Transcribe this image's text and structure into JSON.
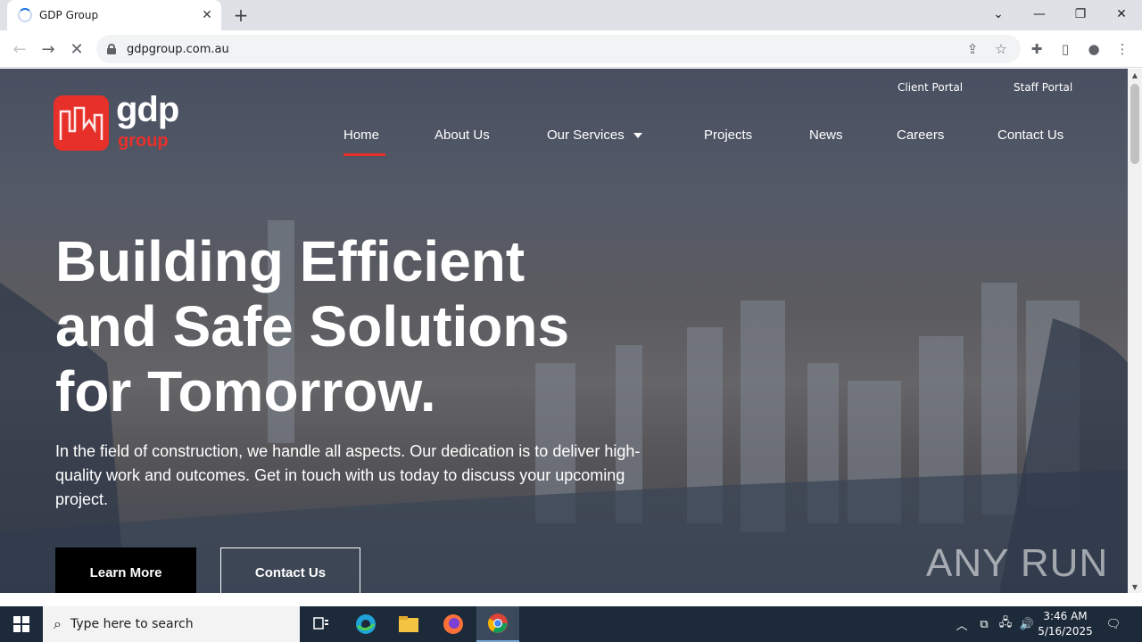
{
  "browser": {
    "tab_title": "GDP Group",
    "url": "gdpgroup.com.au"
  },
  "site": {
    "logo": {
      "main": "gdp",
      "sub": "group"
    },
    "portals": [
      "Client Portal",
      "Staff Portal"
    ],
    "nav": [
      "Home",
      "About Us",
      "Our Services",
      "Projects",
      "News",
      "Careers",
      "Contact Us"
    ],
    "active_nav": "Home",
    "hero": {
      "title_lines": [
        "Building Efficient",
        "and Safe Solutions",
        "for Tomorrow."
      ],
      "description": "In the field of construction, we handle all aspects. Our dedication is to deliver high-quality work and outcomes. Get in touch with us today to discuss your upcoming project.",
      "primary_button": "Learn More",
      "secondary_button": "Contact Us"
    },
    "watermark": "ANY RUN",
    "accent_color": "#e8302a"
  },
  "taskbar": {
    "search_placeholder": "Type here to search",
    "time": "3:46 AM",
    "date": "5/16/2025"
  }
}
